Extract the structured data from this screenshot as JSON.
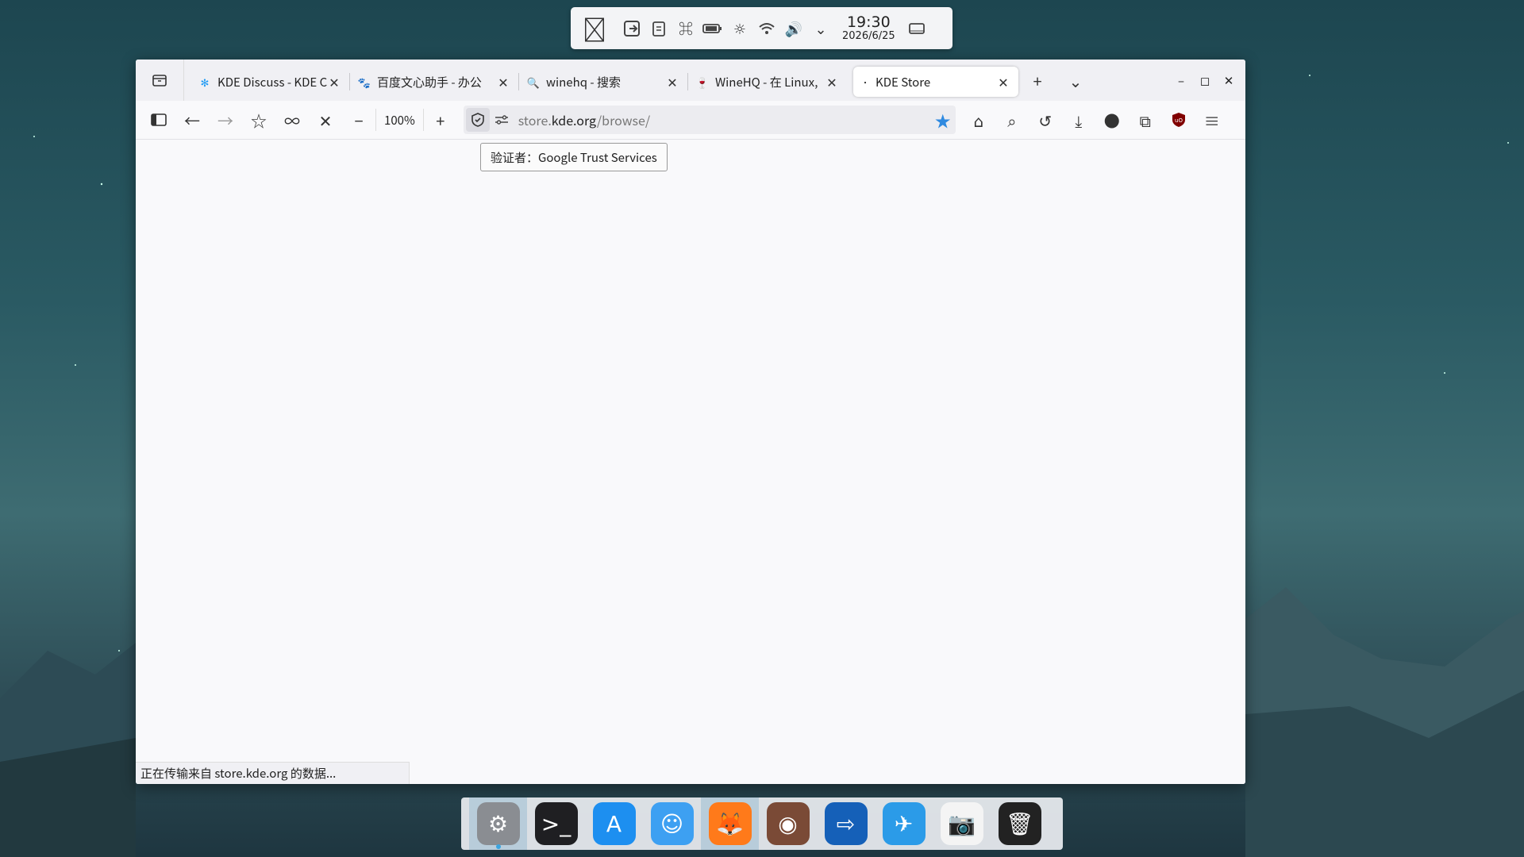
{
  "top_panel": {
    "icons": [
      "apple-icon",
      "app-switcher-icon",
      "clipboard-icon",
      "command-icon",
      "battery-icon",
      "brightness-icon",
      "wifi-icon",
      "volume-icon",
      "chevron-down-icon",
      "display-icon"
    ],
    "time": "19:30",
    "date": "2026/6/25"
  },
  "browser": {
    "tabs": [
      {
        "label": "KDE Discuss - KDE C",
        "icon": "kde-icon",
        "active": false
      },
      {
        "label": "百度文心助手 - 办公",
        "icon": "baidu-icon",
        "active": false
      },
      {
        "label": "winehq - 搜索",
        "icon": "search-icon",
        "active": false
      },
      {
        "label": "WineHQ - 在 Linux,",
        "icon": "wine-icon",
        "active": false
      },
      {
        "label": "KDE Store",
        "icon": "loading-dot",
        "active": true
      }
    ],
    "zoom": "100%",
    "url_prefix": "store.",
    "url_host": "kde.org",
    "url_path": "/browse/",
    "tooltip": "验证者：Google Trust Services",
    "status": "正在传输来自 store.kde.org 的数据..."
  },
  "dock": {
    "apps": [
      {
        "name": "system-settings",
        "glyph": "⚙",
        "color": "#8a8d92",
        "active": true
      },
      {
        "name": "terminal",
        "glyph": ">_",
        "color": "#1f1f22",
        "active": false
      },
      {
        "name": "app-store",
        "glyph": "A",
        "color": "#1d8ff0",
        "active": false
      },
      {
        "name": "finder",
        "glyph": "☺",
        "color": "#3da0f2",
        "active": false
      },
      {
        "name": "firefox",
        "glyph": "🦊",
        "color": "#ff7a1a",
        "active": true
      },
      {
        "name": "app-generic",
        "glyph": "◉",
        "color": "#7a4a36",
        "active": false
      },
      {
        "name": "remote-app",
        "glyph": "⇨",
        "color": "#1560b8",
        "active": false
      },
      {
        "name": "swift-app",
        "glyph": "✈",
        "color": "#2b9be8",
        "active": false
      },
      {
        "name": "screenshot",
        "glyph": "📷",
        "color": "#f4f4f4",
        "active": false
      },
      {
        "name": "trash",
        "glyph": "🗑",
        "color": "#222222",
        "active": false
      }
    ]
  }
}
